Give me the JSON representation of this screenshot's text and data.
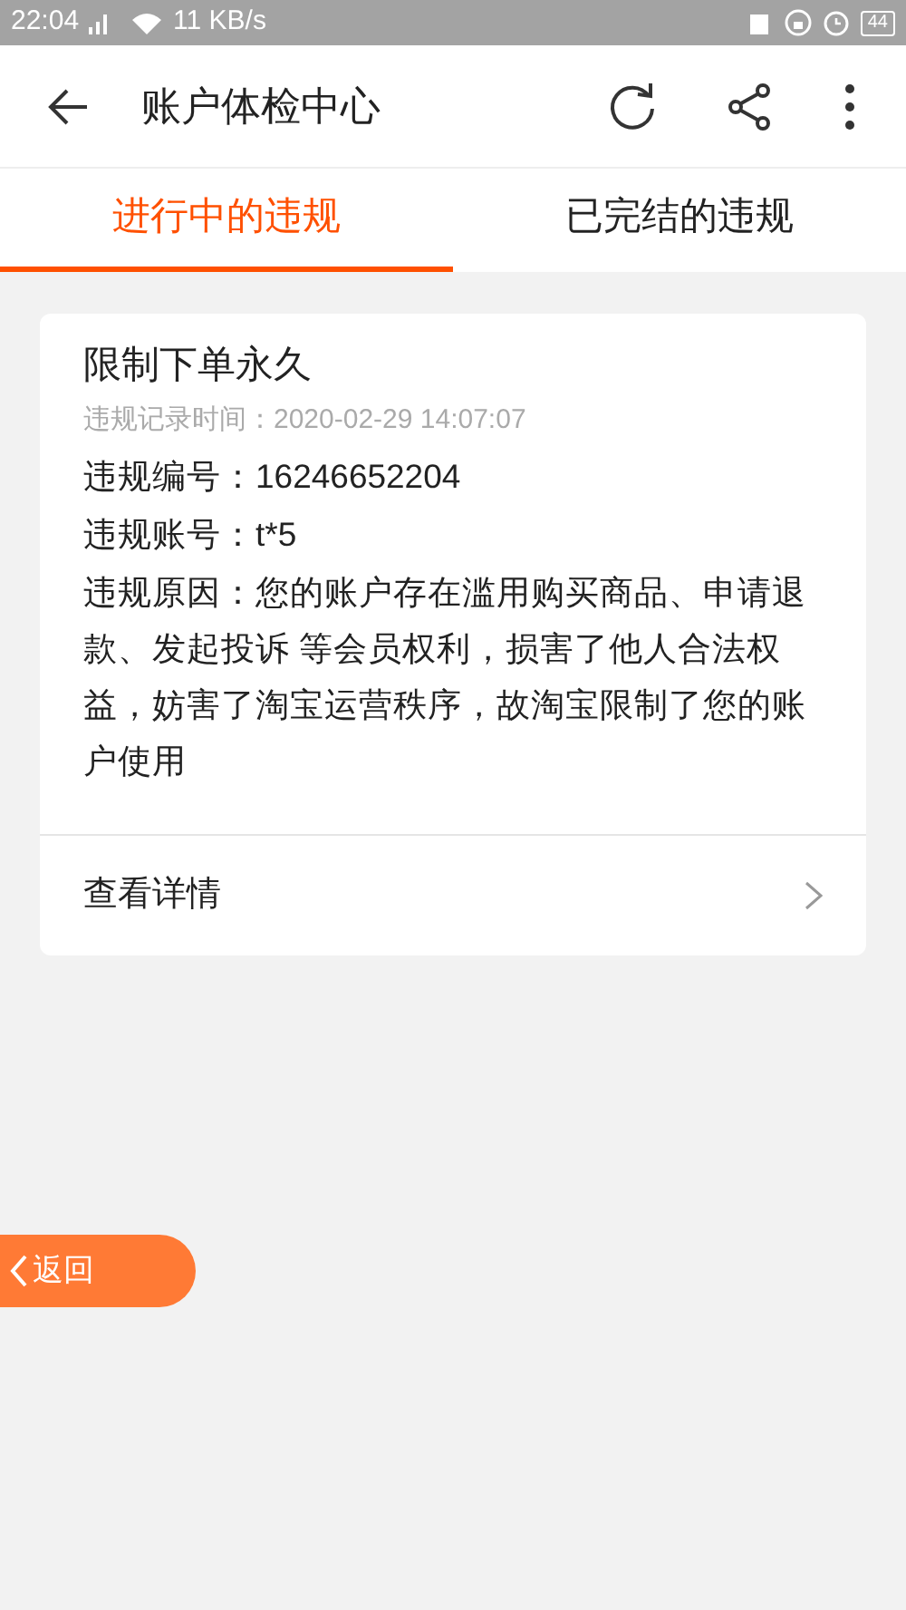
{
  "status_bar": {
    "time": "22:04",
    "speed": "11 KB/s",
    "battery": "44"
  },
  "header": {
    "title": "账户体检中心"
  },
  "tabs": [
    {
      "label": "进行中的违规",
      "selected": true
    },
    {
      "label": "已完结的违规",
      "selected": false
    }
  ],
  "violations": [
    {
      "title": "限制下单永久",
      "time": "违规记录时间：2020-02-29 14:07:07",
      "fields": [
        "违规编号：16246652204",
        "违规账号：t*5",
        "违规原因：您的账户存在滥用购买商品、申请退款、发起投诉 等会员权利，损害了他人合法权益，妨害了淘宝运营秩序，故淘宝限制了您的账户使用"
      ],
      "link": "查看详情"
    }
  ],
  "back_button": {
    "label": "返回"
  }
}
